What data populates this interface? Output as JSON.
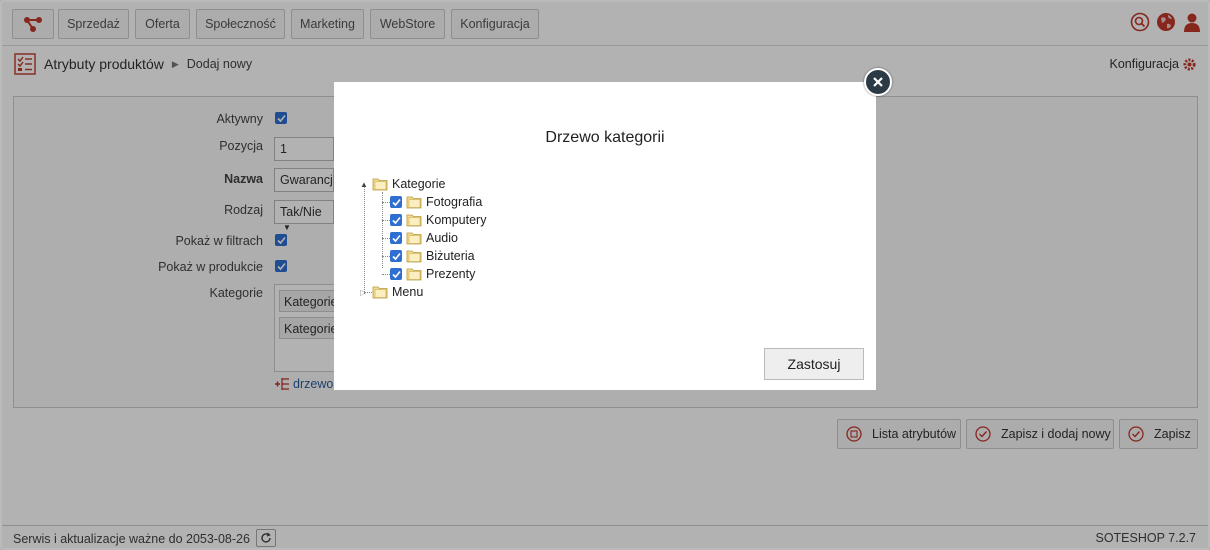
{
  "nav": {
    "items": [
      "Sprzedaż",
      "Oferta",
      "Społeczność",
      "Marketing",
      "WebStore",
      "Konfiguracja"
    ]
  },
  "breadcrumb": {
    "title": "Atrybuty produktów",
    "current": "Dodaj nowy"
  },
  "header_link": "Konfiguracja",
  "form": {
    "aktywny_label": "Aktywny",
    "pozycja_label": "Pozycja",
    "pozycja_value": "1",
    "nazwa_label": "Nazwa",
    "nazwa_value": "Gwarancja",
    "rodzaj_label": "Rodzaj",
    "rodzaj_value": "Tak/Nie",
    "filtry_label": "Pokaż w filtrach",
    "produkcie_label": "Pokaż w produkcie",
    "kategorie_label": "Kategorie",
    "kategorie_chips": [
      "Kategorie",
      "Kategorie"
    ],
    "tree_link": "drzewo"
  },
  "actions": {
    "list": "Lista atrybutów",
    "save_new": "Zapisz i dodaj nowy",
    "save": "Zapisz"
  },
  "footer": {
    "service": "Serwis i aktualizacje ważne do 2053-08-26",
    "version": "SOTESHOP 7.2.7"
  },
  "modal": {
    "title": "Drzewo kategorii",
    "root": "Kategorie",
    "children": [
      "Fotografia",
      "Komputery",
      "Audio",
      "Biżuteria",
      "Prezenty"
    ],
    "menu": "Menu",
    "apply": "Zastosuj"
  },
  "colors": {
    "accent_red": "#c0392b",
    "checkbox_blue": "#2e6fd1",
    "close_dark": "#2b3a45"
  }
}
